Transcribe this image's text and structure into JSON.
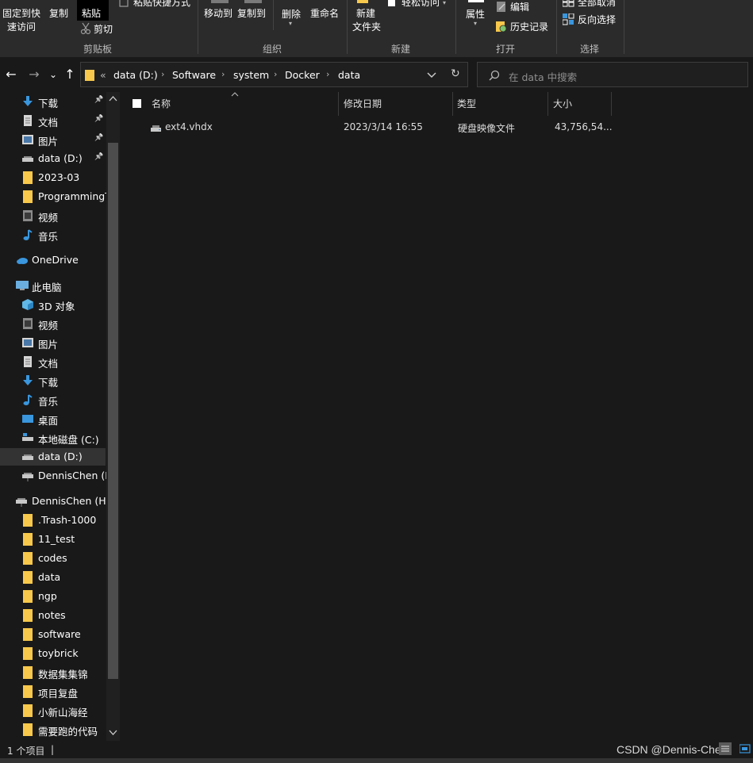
{
  "ribbon": {
    "pin_quick_access": [
      "固定到快",
      "速访问"
    ],
    "copy": "复制",
    "paste": "粘贴",
    "cut": "剪切",
    "paste_shortcut": "粘贴快捷方式",
    "clipboard_group": "剪贴板",
    "move_to": "移动到",
    "copy_to": "复制到",
    "delete": "删除",
    "rename": "重命名",
    "organize_group": "组织",
    "new_folder": [
      "新建",
      "文件夹"
    ],
    "easy_access": "轻松访问",
    "new_group": "新建",
    "properties": "属性",
    "edit": "编辑",
    "history": "历史记录",
    "open_group": "打开",
    "select_none": "全部取消",
    "invert_selection": "反向选择",
    "select_group": "选择"
  },
  "nav": {
    "back": "←",
    "forward": "→",
    "recent": "⌄",
    "up": "↑",
    "overflow": "«",
    "breadcrumbs": [
      "data (D:)",
      "Software",
      "system",
      "Docker",
      "data"
    ],
    "refresh": "↻",
    "search_placeholder": "在 data 中搜索"
  },
  "sidebar": {
    "quick_items": [
      {
        "label": "下载",
        "icon": "download-arrow-icon",
        "pinned": true
      },
      {
        "label": "文档",
        "icon": "document-icon",
        "pinned": true
      },
      {
        "label": "图片",
        "icon": "picture-icon",
        "pinned": true
      },
      {
        "label": "data (D:)",
        "icon": "drive-icon",
        "pinned": true
      },
      {
        "label": "2023-03",
        "icon": "folder-icon",
        "pinned": false
      },
      {
        "label": "ProgrammingT",
        "icon": "folder-icon",
        "pinned": false
      },
      {
        "label": "视频",
        "icon": "video-icon",
        "pinned": false
      },
      {
        "label": "音乐",
        "icon": "music-icon",
        "pinned": false
      }
    ],
    "onedrive": "OneDrive",
    "this_pc": "此电脑",
    "pc_items": [
      {
        "label": "3D 对象",
        "icon": "cube-3d-icon"
      },
      {
        "label": "视频",
        "icon": "video-icon"
      },
      {
        "label": "图片",
        "icon": "picture-icon"
      },
      {
        "label": "文档",
        "icon": "document-icon"
      },
      {
        "label": "下载",
        "icon": "download-arrow-icon"
      },
      {
        "label": "音乐",
        "icon": "music-icon"
      },
      {
        "label": "桌面",
        "icon": "desktop-icon"
      },
      {
        "label": "本地磁盘 (C:)",
        "icon": "windows-drive-icon"
      },
      {
        "label": "data (D:)",
        "icon": "drive-icon"
      },
      {
        "label": "DennisChen (H",
        "icon": "network-drive-icon"
      }
    ],
    "network_drive": "DennisChen (H:)",
    "h_folders": [
      ".Trash-1000",
      "11_test",
      "codes",
      "data",
      "ngp",
      "notes",
      "software",
      "toybrick",
      "数据集集锦",
      "项目复盘",
      "小新山海经",
      "需要跑的代码"
    ]
  },
  "columns": [
    "名称",
    "修改日期",
    "类型",
    "大小"
  ],
  "files": [
    {
      "name": "ext4.vhdx",
      "modified": "2023/3/14 16:55",
      "type": "硬盘映像文件",
      "size": "43,756,54..."
    }
  ],
  "status": {
    "count": "1 个项目",
    "separator": "|",
    "watermark": "CSDN @Dennis-Chen"
  },
  "colors": {
    "background": "#191919",
    "ribbon": "#2b2b2b",
    "folder": "#f7c84b",
    "accent_blue": "#3a96dd",
    "selected": "#333333"
  }
}
